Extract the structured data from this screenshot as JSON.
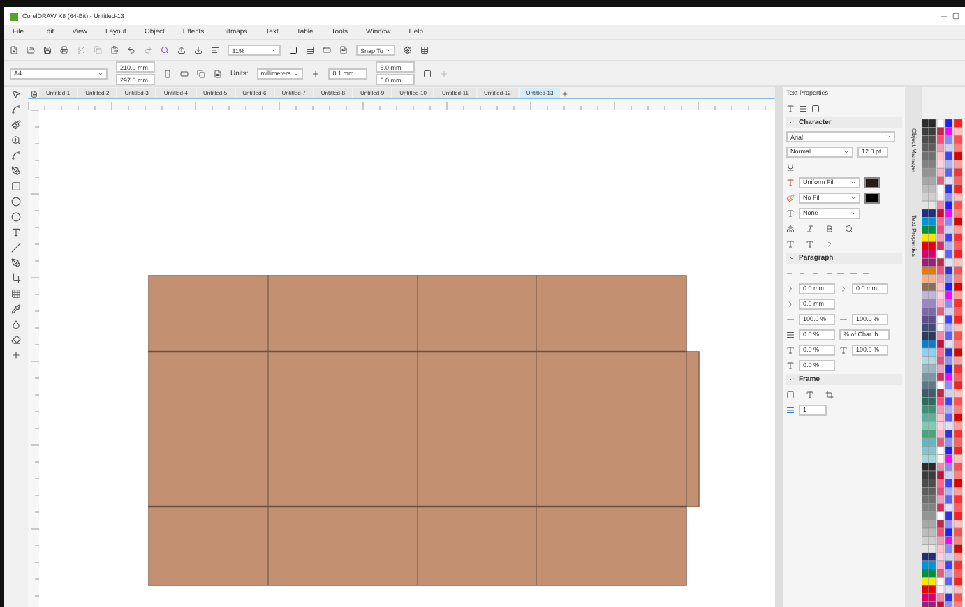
{
  "window": {
    "title": "CorelDRAW X8 (64-Bit) - Untitled-13"
  },
  "menu": [
    "File",
    "Edit",
    "View",
    "Layout",
    "Object",
    "Effects",
    "Bitmaps",
    "Text",
    "Table",
    "Tools",
    "Window",
    "Help"
  ],
  "standard_toolbar": {
    "zoom": "31%",
    "snap": "Snap To"
  },
  "property_bar": {
    "page_size": "A4",
    "width": "210.0 mm",
    "height": "297.0 mm",
    "units_label": "Units:",
    "units": "millimeters",
    "nudge": "0.1 mm",
    "dup_x": "5.0 mm",
    "dup_y": "5.0 mm"
  },
  "document_tabs": [
    {
      "label": "Untitled-1",
      "selected": false
    },
    {
      "label": "Untitled-2",
      "selected": false
    },
    {
      "label": "Untitled-3",
      "selected": false
    },
    {
      "label": "Untitled-4",
      "selected": false
    },
    {
      "label": "Untitled-5",
      "selected": false
    },
    {
      "label": "Untitled-6",
      "selected": false
    },
    {
      "label": "Untitled-7",
      "selected": false
    },
    {
      "label": "Untitled-8",
      "selected": false
    },
    {
      "label": "Untitled-9",
      "selected": false
    },
    {
      "label": "Untitled-10",
      "selected": false
    },
    {
      "label": "Untitled-11",
      "selected": false
    },
    {
      "label": "Untitled-12",
      "selected": false
    },
    {
      "label": "Untitled-13",
      "selected": true
    }
  ],
  "docker": {
    "title": "Text Properties",
    "character": {
      "title": "Character",
      "font": "Arial",
      "style": "Normal",
      "size": "12.0 pt",
      "fill": "Uniform Fill",
      "background": "No Fill",
      "outline": "None"
    },
    "paragraph": {
      "title": "Paragraph",
      "left_indent": "0.0 mm",
      "right_indent": "0.0 mm",
      "first_indent": "0.0 mm",
      "before": "100.0 %",
      "line": "100.0 %",
      "after": "0.0 %",
      "spacing_unit": "% of Char. h...",
      "char_spacing": "0.0 %",
      "word_spacing": "100.0 %",
      "lang_spacing": "0.0 %"
    },
    "frame": {
      "title": "Frame",
      "columns": "1"
    }
  },
  "side_tabs": [
    "Object Manager",
    "Text Properties"
  ]
}
